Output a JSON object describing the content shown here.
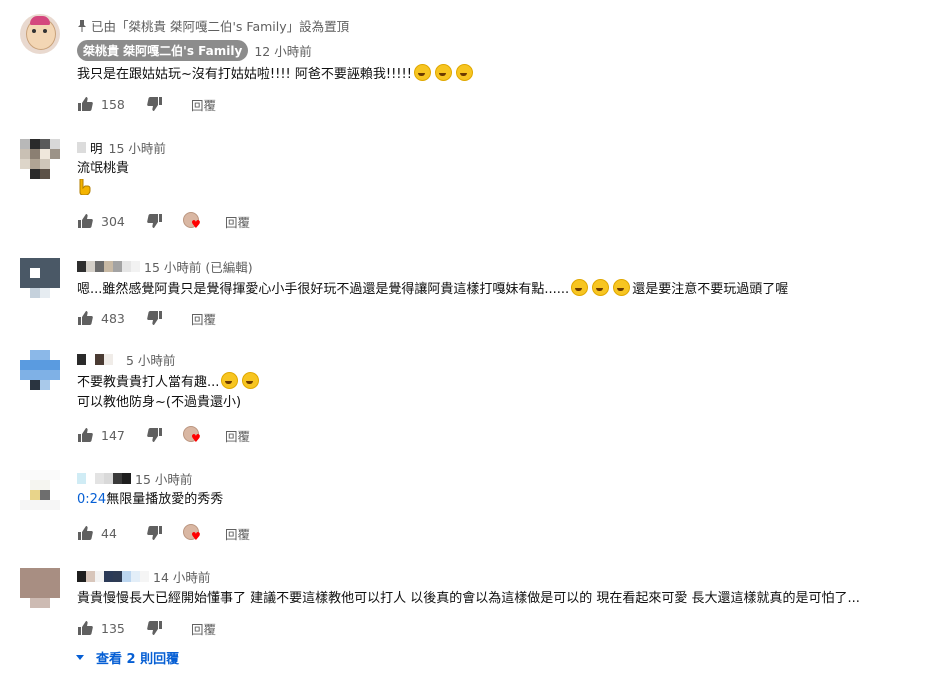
{
  "pinned_label": "已由「桀桃貴 桀阿嘎二伯's Family」設為置頂",
  "comments": [
    {
      "author": "桀桃貴 桀阿嘎二伯's Family",
      "time": "12 小時前",
      "lines": [
        "我只是在跟姑姑玩~沒有打姑姑啦!!!! 阿爸不要誣賴我!!!!!"
      ],
      "likes": "158",
      "reply": "回覆"
    },
    {
      "author": "明",
      "time": "15 小時前",
      "lines": [
        "流氓桃貴"
      ],
      "likes": "304",
      "reply": "回覆",
      "hearted": true
    },
    {
      "author": "",
      "time": "15 小時前 (已編輯)",
      "lines": [
        "嗯...雖然感覺阿貴只是覺得揮愛心小手很好玩不過還是覺得讓阿貴這樣打嘎妹有點......",
        "還是要注意不要玩過頭了喔"
      ],
      "likes": "483",
      "reply": "回覆"
    },
    {
      "author": "",
      "time": "5 小時前",
      "lines": [
        "不要教貴貴打人當有趣...",
        "可以教他防身~(不過貴還小)"
      ],
      "likes": "147",
      "reply": "回覆",
      "hearted": true
    },
    {
      "author": "",
      "time": "15 小時前",
      "timestamp_link": "0:24",
      "lines": [
        "無限量播放愛的秀秀"
      ],
      "likes": "44",
      "reply": "回覆",
      "hearted": true
    },
    {
      "author": "",
      "time": "14 小時前",
      "lines": [
        "貴貴慢慢長大已經開始懂事了 建議不要這樣教他可以打人 以後真的會以為這樣做是可以的 現在看起來可愛 長大還這樣就真的是可怕了..."
      ],
      "likes": "135",
      "reply": "回覆"
    }
  ],
  "view_replies": "查看 2 則回覆",
  "colors": {
    "link": "#065fd4",
    "meta": "#606060",
    "heart": "#ff0000"
  },
  "icons": [
    "pin-icon",
    "thumb-up-icon",
    "thumb-down-icon",
    "heart-icon",
    "dropdown-triangle-icon"
  ]
}
